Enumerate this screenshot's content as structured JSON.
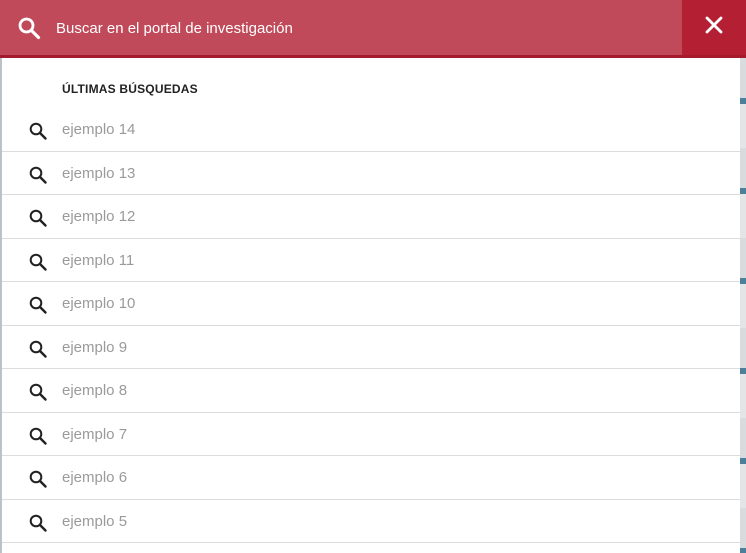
{
  "search": {
    "placeholder": "Buscar en el portal de investigación",
    "value": ""
  },
  "icons": {
    "search": "search-icon",
    "close": "close-icon"
  },
  "colors": {
    "bar_background": "#b51f33",
    "field_background": "#c14a5a",
    "item_text": "#9a9a9a",
    "heading_text": "#222222"
  },
  "recent": {
    "title": "ÚLTIMAS BÚSQUEDAS",
    "items": [
      {
        "label": "ejemplo 14"
      },
      {
        "label": "ejemplo 13"
      },
      {
        "label": "ejemplo 12"
      },
      {
        "label": "ejemplo 11"
      },
      {
        "label": "ejemplo 10"
      },
      {
        "label": "ejemplo 9"
      },
      {
        "label": "ejemplo 8"
      },
      {
        "label": "ejemplo 7"
      },
      {
        "label": "ejemplo 6"
      },
      {
        "label": "ejemplo 5"
      }
    ]
  }
}
